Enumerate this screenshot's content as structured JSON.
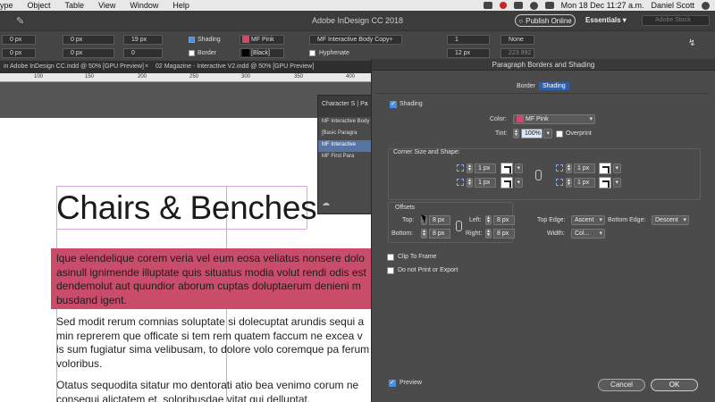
{
  "menubar": {
    "items": [
      "ype",
      "Object",
      "Table",
      "View",
      "Window",
      "Help"
    ],
    "datetime": "Mon 18 Dec  11:27 a.m.",
    "user": "Daniel Scott"
  },
  "appbar": {
    "title": "Adobe InDesign CC 2018",
    "publish_label": "Publish Online",
    "workspace": "Essentials",
    "search_placeholder": "Adobe Stock"
  },
  "control": {
    "f1": "0 px",
    "f2": "0 px",
    "f3": "0 px",
    "f4": "0 px",
    "leading": "19 px",
    "shading_label": "Shading",
    "shading_color": "MF Pink",
    "border_label": "Border",
    "border_color": "[Black]",
    "para_style": "MF Interactive Body Copy+",
    "hyphenate_label": "Hyphenate",
    "cols": "1",
    "none": "None",
    "gutter": "12 px",
    "width": "223.992 px",
    "grid_value": "0"
  },
  "tabs": {
    "doc1": "in Adobe InDesign CC.indd @ 50% [GPU Preview]",
    "doc2": "02 Magazine - Interactive V2.indd @ 50% [GPU Preview]"
  },
  "ruler": [
    "100",
    "150",
    "200",
    "250",
    "300",
    "350",
    "400"
  ],
  "page": {
    "headline": "Chairs & Benches",
    "p1": "lque elendelique corem veria vel eum eosa veliatus nonsere dolo\nasinull ignimende illuptate quis situatus modia volut rendi odis est\ndendemolut aut quundior aborum cuptas doluptaerum denieni m\nbusdand igent.",
    "p2": "Sed modit rerum comnias soluptate si dolecuptat arundis sequi a\nmin reprerem que officate si tem rem quatem faccum ne excea v\nis sum fugiatur sima velibusam, to dolore volo coremque pa ferum\nvoloribus.",
    "p3": "Otatus sequodita sitatur mo dentorati atio bea venimo corum ne\nconsequi alictatem et, soloribusdae vitat qui delluptat."
  },
  "charpanel": {
    "title": "Character S",
    "tab2": "Pa",
    "items": [
      "MF Interactive Body C",
      "[Basic Paragra",
      "MF Interactive",
      "MF First Para"
    ]
  },
  "dialog": {
    "title": "Paragraph Borders and Shading",
    "tab_border": "Border",
    "tab_shading": "Shading",
    "shading_label": "Shading",
    "color_label": "Color:",
    "color_value": "MF Pink",
    "tint_label": "Tint:",
    "tint_value": "100%",
    "overprint_label": "Overprint",
    "corner_label": "Corner Size and Shape:",
    "corner_vals": [
      "1 px",
      "1 px",
      "1 px",
      "1 px"
    ],
    "offsets_label": "Offsets",
    "top_label": "Top:",
    "top_value": "8 px",
    "bottom_label": "Bottom:",
    "bottom_value": "8 px",
    "left_label": "Left:",
    "left_value": "8 px",
    "right_label": "Right:",
    "right_value": "8 px",
    "top_edge_label": "Top Edge:",
    "top_edge_value": "Ascent",
    "bottom_edge_label": "Bottom Edge:",
    "bottom_edge_value": "Descent",
    "width_label": "Width:",
    "width_value": "Col...",
    "clip_label": "Clip To Frame",
    "noprint_label": "Do not Print or Export",
    "preview_label": "Preview",
    "cancel_label": "Cancel",
    "ok_label": "OK"
  },
  "colors": {
    "shading": "#c94d6a",
    "accent": "#2e5fa8"
  }
}
